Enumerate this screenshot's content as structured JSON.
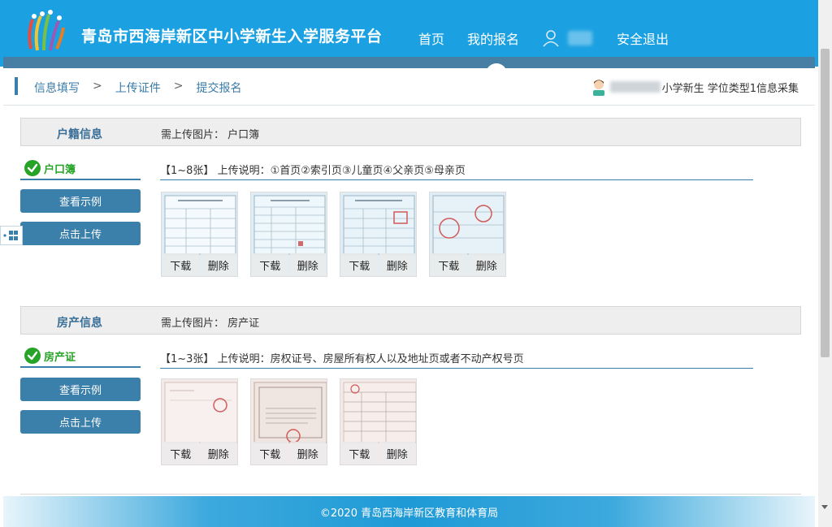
{
  "header": {
    "site_title": "青岛市西海岸新区中小学新生入学服务平台",
    "nav": [
      {
        "label": "首页"
      },
      {
        "label": "我的报名"
      }
    ],
    "logout_label": "安全退出"
  },
  "breadcrumb": {
    "steps": [
      "信息填写",
      "上传证件",
      "提交报名"
    ],
    "separator": ">"
  },
  "user_info": {
    "text": "小学新生 学位类型1信息采集"
  },
  "sections": [
    {
      "title": "户籍信息",
      "required_label": "需上传图片：",
      "required_doc": "户口簿",
      "doc": {
        "label": "户口簿",
        "count_range": "【1~8张】",
        "desc_label": "上传说明：",
        "desc": "①首页②索引页③儿童页④父亲页⑤母亲页",
        "sample_button": "查看示例",
        "upload_button": "点击上传",
        "thumbnails": [
          {
            "download": "下载",
            "delete": "删除"
          },
          {
            "download": "下载",
            "delete": "删除"
          },
          {
            "download": "下载",
            "delete": "删除"
          },
          {
            "download": "下载",
            "delete": "删除"
          }
        ]
      }
    },
    {
      "title": "房产信息",
      "required_label": "需上传图片：",
      "required_doc": "房产证",
      "doc": {
        "label": "房产证",
        "count_range": "【1~3张】",
        "desc_label": "上传说明：",
        "desc": "房权证号、房屋所有权人以及地址页或者不动产权号页",
        "sample_button": "查看示例",
        "upload_button": "点击上传",
        "thumbnails": [
          {
            "download": "下载",
            "delete": "删除"
          },
          {
            "download": "下载",
            "delete": "删除"
          },
          {
            "download": "下载",
            "delete": "删除"
          }
        ]
      }
    }
  ],
  "footer": {
    "text": "©2020 青岛西海岸新区教育和体育局"
  },
  "colors": {
    "header_bg": "#1ba1e2",
    "accent": "#3b7fab",
    "success_green": "#27a327"
  },
  "icons": [
    "logo-icon",
    "user-icon",
    "avatar-icon",
    "check-circle-icon",
    "grid-icon"
  ]
}
